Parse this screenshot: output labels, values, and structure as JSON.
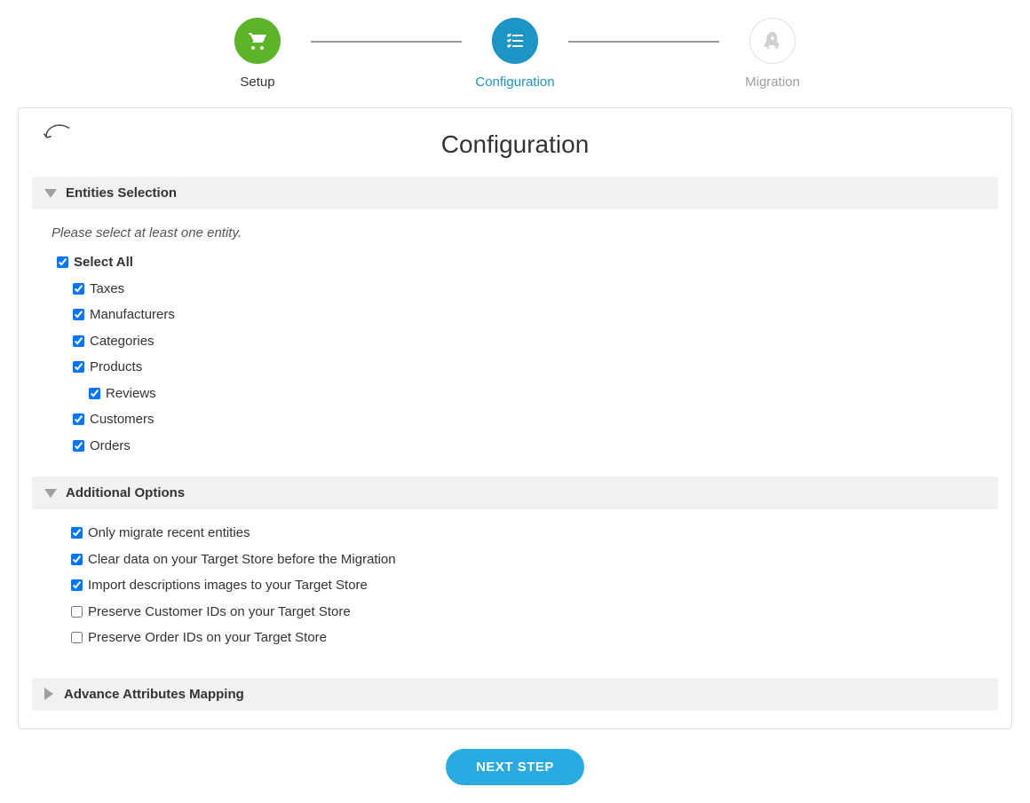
{
  "stepper": {
    "steps": [
      {
        "label": "Setup"
      },
      {
        "label": "Configuration"
      },
      {
        "label": "Migration"
      }
    ]
  },
  "page": {
    "title": "Configuration"
  },
  "entities_section": {
    "title": "Entities Selection",
    "helper": "Please select at least one entity.",
    "select_all_label": "Select All",
    "items": {
      "taxes": "Taxes",
      "manufacturers": "Manufacturers",
      "categories": "Categories",
      "products": "Products",
      "reviews": "Reviews",
      "customers": "Customers",
      "orders": "Orders"
    }
  },
  "options_section": {
    "title": "Additional Options",
    "items": {
      "recent": {
        "label": "Only migrate recent entities",
        "checked": true
      },
      "clear": {
        "label": "Clear data on your Target Store before the Migration",
        "checked": true
      },
      "import_images": {
        "label": "Import descriptions images to your Target Store",
        "checked": true
      },
      "preserve_customer_ids": {
        "label": "Preserve Customer IDs on your Target Store",
        "checked": false
      },
      "preserve_order_ids": {
        "label": "Preserve Order IDs on your Target Store",
        "checked": false
      }
    }
  },
  "advanced_section": {
    "title": "Advance Attributes Mapping"
  },
  "buttons": {
    "next": "NEXT STEP"
  }
}
